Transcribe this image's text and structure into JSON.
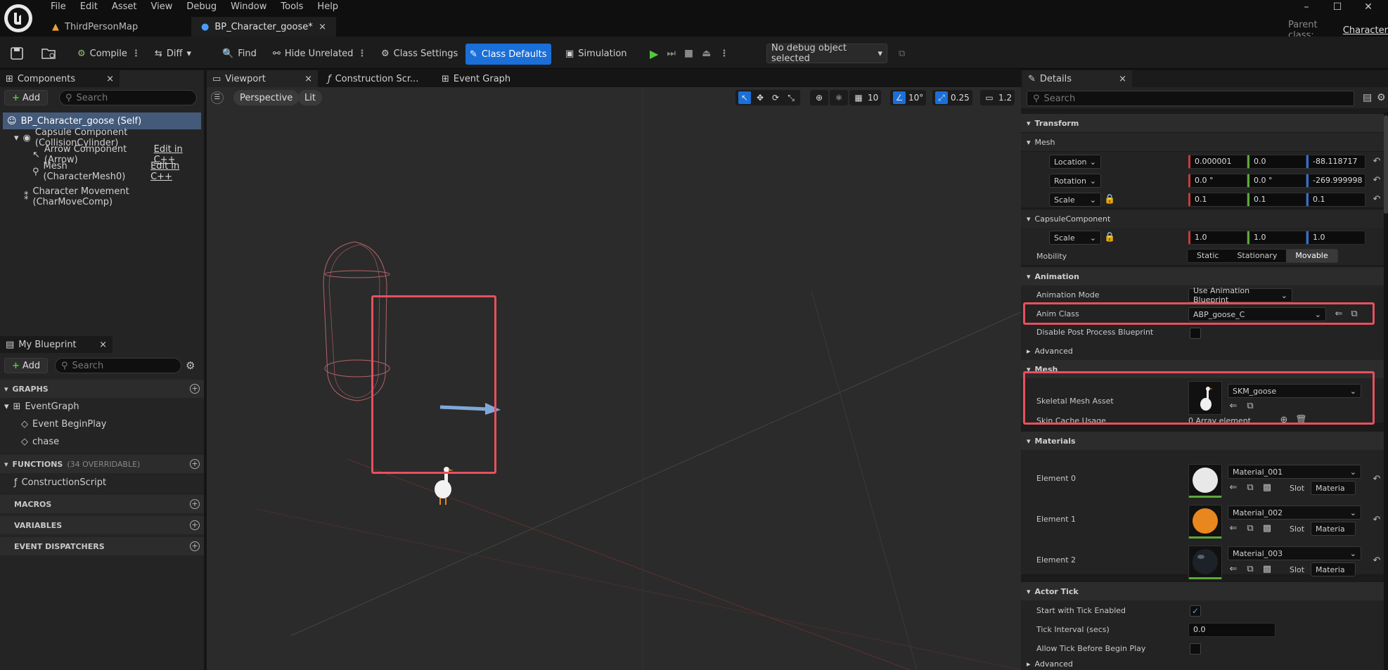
{
  "menu": [
    "File",
    "Edit",
    "Asset",
    "View",
    "Debug",
    "Window",
    "Tools",
    "Help"
  ],
  "doc_tabs": [
    {
      "label": "ThirdPersonMap"
    },
    {
      "label": "BP_Character_goose*"
    }
  ],
  "parent_class": {
    "label": "Parent class:",
    "value": "Character"
  },
  "toolbar": {
    "compile": "Compile",
    "diff": "Diff",
    "find": "Find",
    "hide_unrelated": "Hide Unrelated",
    "class_settings": "Class Settings",
    "class_defaults": "Class Defaults",
    "simulation": "Simulation",
    "debug_object": "No debug object selected"
  },
  "components": {
    "tab": "Components",
    "add": "Add",
    "search_placeholder": "Search",
    "items": [
      {
        "label": "BP_Character_goose (Self)"
      },
      {
        "label": "Capsule Component (CollisionCylinder)"
      },
      {
        "label": "Arrow Component (Arrow)",
        "action": "Edit in C++"
      },
      {
        "label": "Mesh (CharacterMesh0)",
        "action": "Edit in C++"
      },
      {
        "label": "Character Movement (CharMoveComp)"
      }
    ]
  },
  "my_blueprint": {
    "tab": "My Blueprint",
    "add": "Add",
    "search_placeholder": "Search",
    "graphs": "GRAPHS",
    "event_graph": "EventGraph",
    "event_begin_play": "Event BeginPlay",
    "chase": "chase",
    "functions": "FUNCTIONS",
    "functions_count": "(34 OVERRIDABLE)",
    "construction_script": "ConstructionScript",
    "macros": "MACROS",
    "variables": "VARIABLES",
    "event_dispatchers": "EVENT DISPATCHERS"
  },
  "editor_tabs": [
    {
      "label": "Viewport"
    },
    {
      "label": "Construction Scr..."
    },
    {
      "label": "Event Graph"
    }
  ],
  "viewport": {
    "perspective": "Perspective",
    "lit": "Lit",
    "grid": "10",
    "angle": "10°",
    "scale": "0.25",
    "camera_speed": "1.2"
  },
  "details": {
    "tab": "Details",
    "search_placeholder": "Search",
    "transform": "Transform",
    "mesh_group": "Mesh",
    "location": {
      "label": "Location",
      "x": "0.000001",
      "y": "0.0",
      "z": "-88.118717"
    },
    "rotation": {
      "label": "Rotation",
      "x": "0.0 °",
      "y": "0.0 °",
      "z": "-269.999998"
    },
    "scale": {
      "label": "Scale",
      "x": "0.1",
      "y": "0.1",
      "z": "0.1"
    },
    "capsule": "CapsuleComponent",
    "capsule_scale": {
      "label": "Scale",
      "x": "1.0",
      "y": "1.0",
      "z": "1.0"
    },
    "mobility": {
      "label": "Mobility",
      "options": [
        "Static",
        "Stationary",
        "Movable"
      ],
      "selected": "Movable"
    },
    "animation": "Animation",
    "animation_mode": {
      "label": "Animation Mode",
      "value": "Use Animation Blueprint"
    },
    "anim_class": {
      "label": "Anim Class",
      "value": "ABP_goose_C"
    },
    "disable_pp": "Disable Post Process Blueprint",
    "advanced": "Advanced",
    "mesh_section": "Mesh",
    "skeletal_mesh": {
      "label": "Skeletal Mesh Asset",
      "value": "SKM_goose"
    },
    "skin_cache": {
      "label": "Skin Cache Usage",
      "value": "0 Array element"
    },
    "materials": "Materials",
    "elements": [
      {
        "label": "Element 0",
        "value": "Material_001",
        "slot": "Slot",
        "slot_value": "Materia",
        "color": "#e8e8e8"
      },
      {
        "label": "Element 1",
        "value": "Material_002",
        "slot": "Slot",
        "slot_value": "Materia",
        "color": "#e8871e"
      },
      {
        "label": "Element 2",
        "value": "Material_003",
        "slot": "Slot",
        "slot_value": "Materia",
        "color": "#1d2128"
      }
    ],
    "actor_tick": "Actor Tick",
    "start_tick": "Start with Tick Enabled",
    "tick_interval": {
      "label": "Tick Interval (secs)",
      "value": "0.0"
    },
    "allow_tick": "Allow Tick Before Begin Play",
    "advanced2": "Advanced"
  },
  "colors": {
    "accent": "#1a6fd8",
    "highlight": "#e8505e"
  }
}
